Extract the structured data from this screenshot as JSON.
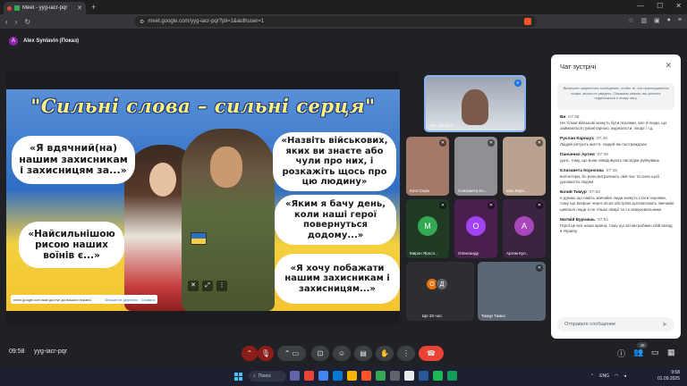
{
  "browser": {
    "tab_title": "Meet - yyg-iacr-pqr",
    "url": "meet.google.com/yyg-iacr-pqr?pli=1&authuser=1"
  },
  "meeting": {
    "presenter": "Alex Synlavin (Показ)",
    "presenter_initial": "A",
    "time": "09:58",
    "code": "yyg-iacr-pqr",
    "participants_count": "39"
  },
  "slide": {
    "title": "\"Сильні слова – сильні серця\"",
    "bubbles": [
      "«Я вдячний(на) нашим захисникам і захисницям за...»",
      "«Назвіть військових, яких ви знаєте або чули про них, і розкажіть щось про цю людину»",
      "«Найсильнішою рисою наших воїнів є...»",
      "«Яким я бачу день, коли наші герої повернуться додому...»",
      "«Я хочу побажати нашим захисникам і захисницям...»"
    ],
    "toast": {
      "text": "meet.google.com має доступ до вашого екрана.",
      "stop": "Більше не ділитися",
      "hide": "Сховати"
    }
  },
  "participants": [
    {
      "name": "Alex Synlavin",
      "color": "#8ab4f8"
    },
    {
      "name": "Катя Серік",
      "color": "#a37a67"
    },
    {
      "name": "Єлизавета Ко...",
      "color": "#8f8f94"
    },
    {
      "name": "Іван Карн...",
      "color": "#b9a28f"
    },
    {
      "name": "Мирон Яросл...",
      "color": "#34a853",
      "initial": "М"
    },
    {
      "name": "Олександр",
      "color": "#a142f4",
      "initial": "О"
    },
    {
      "name": "Артем Кул..",
      "color": "#ab47bc",
      "initial": "А"
    },
    {
      "name": "Ще 20 чол.",
      "initials": [
        "О",
        "Д"
      ]
    },
    {
      "name": "Тимур Тимко",
      "color": "#5c6775"
    }
  ],
  "chat": {
    "title": "Чат зустрічі",
    "note": "Включите закреплять сообщение, чтобы те, кто присоединится позже, могли их увидеть. Покажем значок, вы успеете подписаться к этому чату.",
    "messages": [
      {
        "author": "Ви",
        "time": "07:48",
        "text": "Не тільки військові можуть бути героями, але й люди, що займаються гуманітарною, журналісти, лікарі і т.д."
      },
      {
        "author": "Руслан Карнаух",
        "time": "07:49",
        "text": "Людей рятують життя. людей які постраждали"
      },
      {
        "author": "Панченко Артем",
        "time": "07:49",
        "text": "донс, тому, що вони ліквідовують наслідки руйнувань"
      },
      {
        "author": "Єлизавета Корнєєва",
        "time": "07:49",
        "text": "волонтери, бо вони витрачають свій час та сили щоб допомогти людям"
      },
      {
        "author": "Білий Тимур",
        "time": "07:50",
        "text": "я думаю що навіть звичайні люди можуть стати героями, тому що вперше через після обстрілів допомогають звичайні цивільні люди а не тільки лікарі та т.к євакуювальники"
      },
      {
        "author": "Матвій Бурчишь",
        "time": "07:51",
        "text": "Герої це вся наша країна, тому що всі ми робимо свій вклад в Україну"
      }
    ],
    "input_placeholder": "Отправьте сообщение"
  },
  "taskbar": {
    "search": "Поиск",
    "lang": "ENG",
    "clock_time": "9:58",
    "clock_date": "01.09.2025"
  },
  "colors": {
    "accent": "#8ab4f8",
    "end_call": "#ea4335",
    "muted": "#8c1d18"
  }
}
